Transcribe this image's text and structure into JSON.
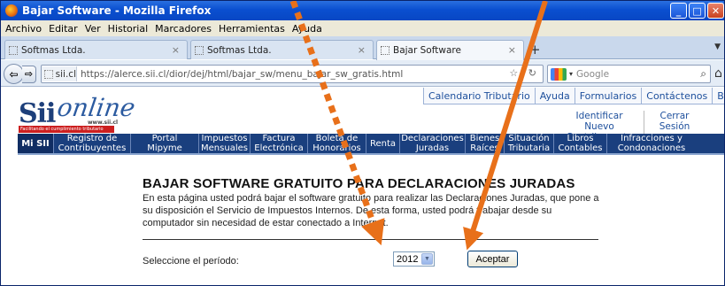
{
  "window": {
    "title": "Bajar Software - Mozilla Firefox"
  },
  "menubar": [
    "Archivo",
    "Editar",
    "Ver",
    "Historial",
    "Marcadores",
    "Herramientas",
    "Ayuda"
  ],
  "tabs": [
    {
      "label": "Softmas Ltda.",
      "active": false
    },
    {
      "label": "Softmas Ltda.",
      "active": false
    },
    {
      "label": "Bajar Software",
      "active": true
    }
  ],
  "nav": {
    "site_label": "sii.cl",
    "url": "https://alerce.sii.cl/dior/dej/html/bajar_sw/menu_bajar_sw_gratis.html",
    "search_placeholder": "Google"
  },
  "logo": {
    "text_sii": "Sii",
    "text_online": "online",
    "text_www": "www.sii.cl",
    "slogan": "Facilitando el cumplimiento tributario"
  },
  "toplinks": [
    "Calendario Tributario",
    "Ayuda",
    "Formularios",
    "Contáctenos",
    "Buscar"
  ],
  "userlinks": {
    "identify": "Identificar Nuevo Contribuyente",
    "logout": "Cerrar Sesión"
  },
  "mainnav": [
    "Mi SII",
    "Registro de Contribuyentes",
    "Portal Mipyme",
    "Impuestos Mensuales",
    "Factura Electrónica",
    "Boleta de Honorarios",
    "Renta",
    "Declaraciones Juradas",
    "Bienes Raíces",
    "Situación Tributaria",
    "Libros Contables",
    "Infracciones y Condonaciones"
  ],
  "page": {
    "title": "BAJAR SOFTWARE GRATUITO PARA DECLARACIONES JURADAS",
    "description": "En esta página usted podrá bajar el software gratuito para realizar las Declaraciones Juradas, que pone a su disposición el Servicio de Impuestos Internos. De esta forma, usted podrá trabajar desde su computador sin necesidad de estar conectado a Internet.",
    "period_label": "Seleccione el período:",
    "period_value": "2012",
    "submit_label": "Aceptar"
  },
  "colors": {
    "annotation_arrow": "#e8701a",
    "nav_blue": "#1a3f7e"
  }
}
